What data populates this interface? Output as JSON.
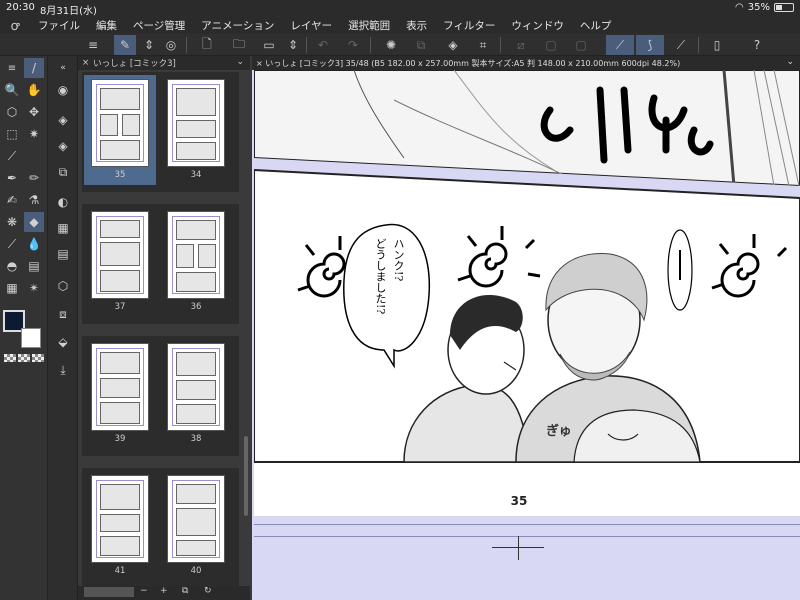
{
  "status": {
    "time": "20:30",
    "date": "8月31日(水)",
    "battery": "35%",
    "battery_level": 0.35
  },
  "menu": {
    "items": [
      "ファイル",
      "編集",
      "ページ管理",
      "アニメーション",
      "レイヤー",
      "選択範囲",
      "表示",
      "フィルター",
      "ウィンドウ",
      "ヘルプ"
    ]
  },
  "pages_panel": {
    "tab_label": "いっしょ [コミック3]",
    "pages": [
      {
        "label": "35",
        "selected": true
      },
      {
        "label": "34",
        "selected": false
      },
      {
        "label": "37",
        "selected": false
      },
      {
        "label": "36",
        "selected": false
      },
      {
        "label": "39",
        "selected": false
      },
      {
        "label": "38",
        "selected": false
      },
      {
        "label": "41",
        "selected": false
      },
      {
        "label": "40",
        "selected": false
      }
    ],
    "bottom_controls": [
      "−",
      "+"
    ]
  },
  "canvas": {
    "tab_label": "いっしょ [コミック3] 35/48 (B5 182.00 x 257.00mm 製本サイズ:A5 判 148.00 x 210.00mm 600dpi 48.2%)",
    "speech_bubble": [
      "ハンク!?",
      "どうしました!?"
    ],
    "sfx": "ぎゅ",
    "page_number": "35"
  },
  "colors": {
    "main_color": "#0d1a33",
    "sub_color": "#ffffff",
    "accent": "#4a5d7a",
    "canvas_bg": "#d8d8f4"
  }
}
